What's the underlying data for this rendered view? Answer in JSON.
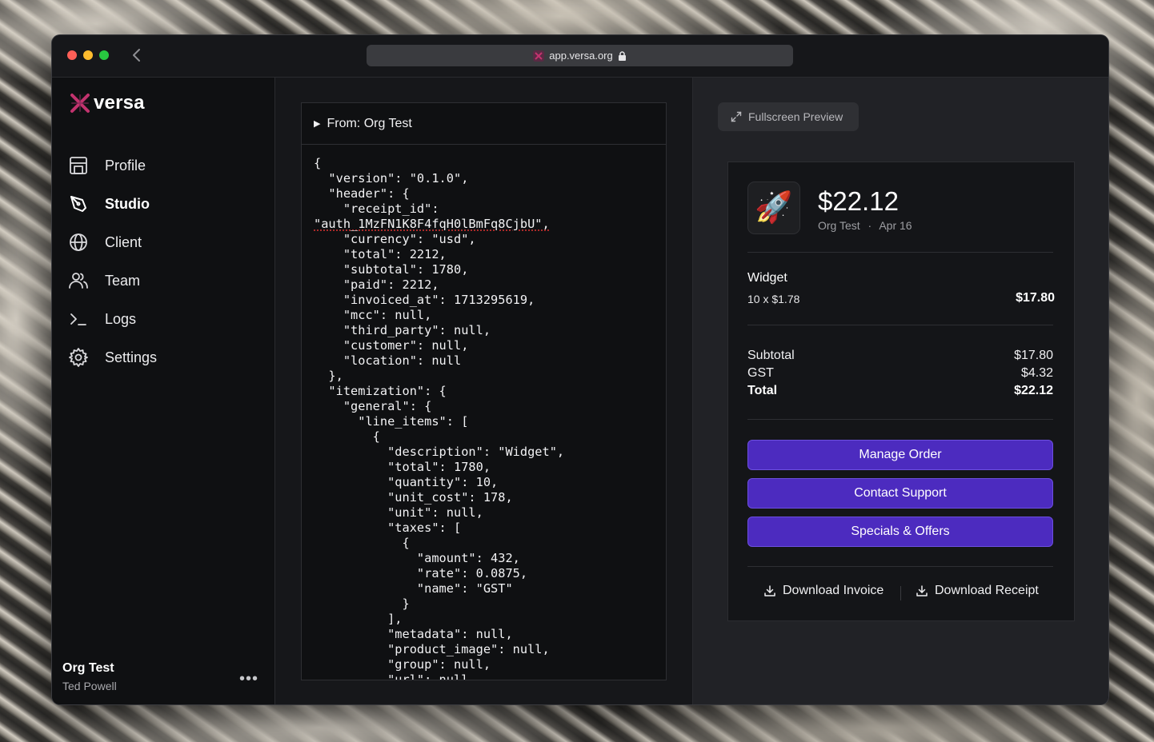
{
  "browser": {
    "url": "app.versa.org",
    "icons": {
      "back": "chevron-left-icon",
      "favicon": "versa-favicon-icon",
      "lock": "lock-icon"
    }
  },
  "sidebar": {
    "brand": "versa",
    "brand_color": "#c2336e",
    "items": [
      {
        "label": "Profile",
        "icon": "storefront-icon"
      },
      {
        "label": "Studio",
        "icon": "pen-tool-icon",
        "active": true
      },
      {
        "label": "Client",
        "icon": "globe-icon"
      },
      {
        "label": "Team",
        "icon": "users-icon"
      },
      {
        "label": "Logs",
        "icon": "terminal-icon"
      },
      {
        "label": "Settings",
        "icon": "gear-icon"
      }
    ],
    "user": {
      "org": "Org Test",
      "name": "Ted Powell"
    }
  },
  "middle": {
    "details_summary": "From: Org Test",
    "json_lines": [
      "{",
      "  \"version\": \"0.1.0\",",
      "  \"header\": {",
      "    \"receipt_id\":",
      "\"auth_1MzFN1K8F4fqH0lBmFq8CjbU\",",
      "    \"currency\": \"usd\",",
      "    \"total\": 2212,",
      "    \"subtotal\": 1780,",
      "    \"paid\": 2212,",
      "    \"invoiced_at\": 1713295619,",
      "    \"mcc\": null,",
      "    \"third_party\": null,",
      "    \"customer\": null,",
      "    \"location\": null",
      "  },",
      "  \"itemization\": {",
      "    \"general\": {",
      "      \"line_items\": [",
      "        {",
      "          \"description\": \"Widget\",",
      "          \"total\": 1780,",
      "          \"quantity\": 10,",
      "          \"unit_cost\": 178,",
      "          \"unit\": null,",
      "          \"taxes\": [",
      "            {",
      "              \"amount\": 432,",
      "              \"rate\": 0.0875,",
      "              \"name\": \"GST\"",
      "            }",
      "          ],",
      "          \"metadata\": null,",
      "          \"product_image\": null,",
      "          \"group\": null,",
      "          \"url\": null"
    ]
  },
  "preview": {
    "fullscreen_label": "Fullscreen Preview",
    "receipt": {
      "icon_glyph": "🚀",
      "amount": "$22.12",
      "merchant": "Org Test",
      "separator": "·",
      "date": "Apr 16",
      "item": {
        "name": "Widget",
        "qty_line": "10 x $1.78",
        "price": "$17.80"
      },
      "totals": [
        {
          "label": "Subtotal",
          "value": "$17.80"
        },
        {
          "label": "GST",
          "value": "$4.32"
        },
        {
          "label": "Total",
          "value": "$22.12"
        }
      ],
      "buttons": [
        "Manage Order",
        "Contact Support",
        "Specials & Offers"
      ],
      "button_color": "#4c2bbf",
      "downloads": [
        {
          "label": "Download Invoice",
          "icon": "download-icon"
        },
        {
          "label": "Download Receipt",
          "icon": "download-icon"
        }
      ]
    }
  }
}
